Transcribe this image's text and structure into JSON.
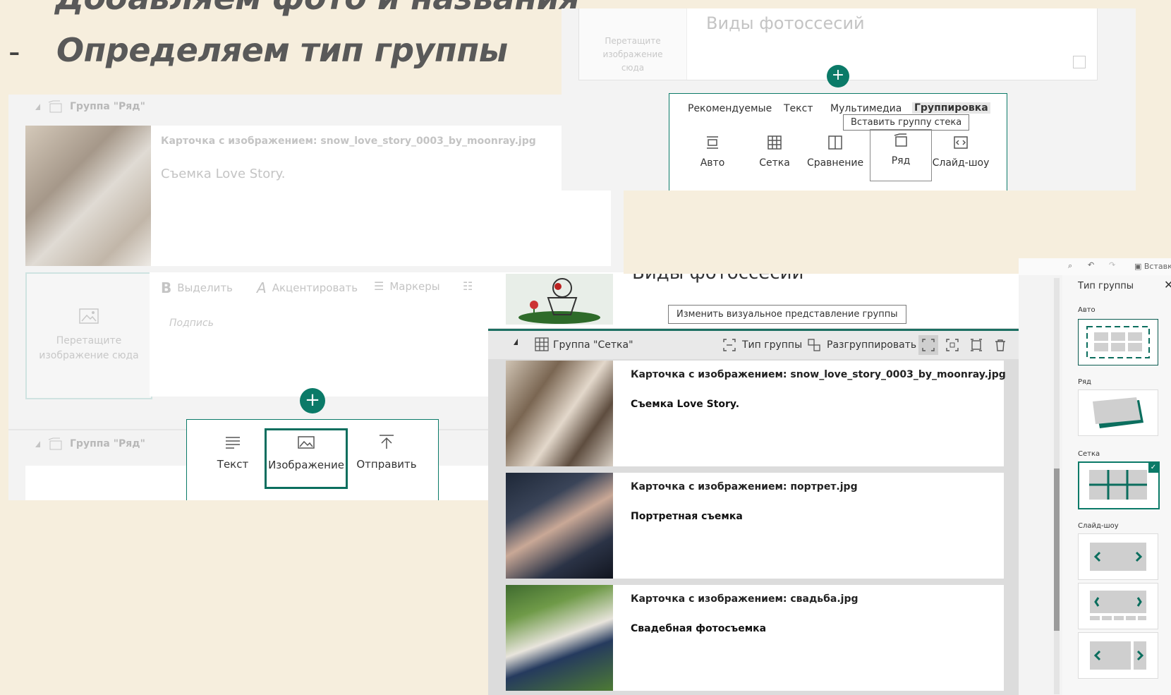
{
  "slide": {
    "line1": "Добавляем фото и названия",
    "dash": "-",
    "line2": "Определяем тип группы"
  },
  "left_shot": {
    "group_header": "Группа \"Ряд\"",
    "card_title": "Карточка с изображением: snow_love_story_0003_by_moonray.jpg",
    "card_caption": "Съемка Love Story.",
    "drop_text": "Перетащите изображение сюда",
    "format": {
      "bold": "Выделить",
      "accent": "Акцентировать",
      "bullets": "Маркеры"
    },
    "caption_placeholder": "Подпись",
    "group_header_2": "Группа \"Ряд\"",
    "insert_items": [
      "Текст",
      "Изображение",
      "Отправить"
    ]
  },
  "top_right_shot": {
    "drop_text": "Перетащите изображение сюда",
    "title_placeholder": "Виды фотоссесий",
    "tabs": [
      "Рекомендуемые",
      "Текст",
      "Мультимедиа",
      "Группировка"
    ],
    "tooltip": "Вставить группу стека",
    "items": [
      "Авто",
      "Сетка",
      "Сравнение",
      "Ряд",
      "Слайд-шоу"
    ]
  },
  "bottom_shot": {
    "header_partial": "Виды фотоссесий",
    "tooltip": "Изменить визуальное представление группы",
    "group_label": "Группа \"Сетка\"",
    "toolbar": {
      "group_type": "Тип группы",
      "ungroup": "Разгруппировать"
    },
    "cards": [
      {
        "title": "Карточка с изображением: snow_love_story_0003_by_moonray.jpg",
        "caption": "Съемка Love Story."
      },
      {
        "title": "Карточка с изображением: портрет.jpg",
        "caption": "Портретная съемка"
      },
      {
        "title": "Карточка с изображением: свадьба.jpg",
        "caption": "Свадебная фотосъемка"
      }
    ]
  },
  "side_pane": {
    "toolbar_insert": "Вставка",
    "title": "Тип группы",
    "options": [
      "Авто",
      "Ряд",
      "Сетка",
      "Слайд-шоу"
    ],
    "selected": "Сетка"
  },
  "colors": {
    "accent": "#0b7a68",
    "background": "#f6eedd"
  }
}
